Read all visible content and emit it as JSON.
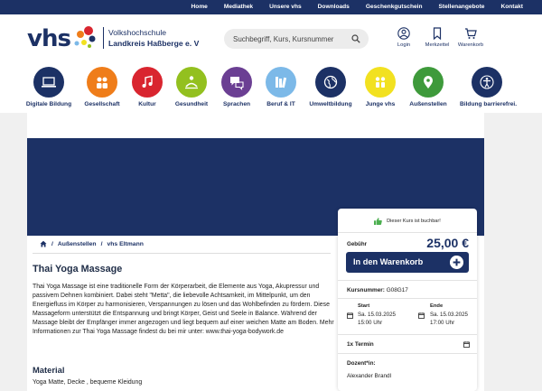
{
  "topnav": [
    "Home",
    "Mediathek",
    "Unsere vhs",
    "Downloads",
    "Geschenkgutschein",
    "Stellenangebote",
    "Kontakt"
  ],
  "logo": {
    "text": "vhs",
    "org_line1": "Volkshochschule",
    "org_line2": "Landkreis Haßberge e. V"
  },
  "search": {
    "placeholder": "Suchbegriff, Kurs, Kursnummer"
  },
  "header_icons": [
    {
      "label": "Login",
      "icon": "user-icon"
    },
    {
      "label": "Merkzettel",
      "icon": "bookmark-icon"
    },
    {
      "label": "Warenkorb",
      "icon": "cart-icon"
    }
  ],
  "categories": [
    {
      "label": "Digitale Bildung",
      "color": "#1c3165",
      "icon": "laptop-icon"
    },
    {
      "label": "Gesellschaft",
      "color": "#ef7d1a",
      "icon": "people-icon"
    },
    {
      "label": "Kultur",
      "color": "#d9252f",
      "icon": "music-icon"
    },
    {
      "label": "Gesundheit",
      "color": "#93c01f",
      "icon": "wellness-icon"
    },
    {
      "label": "Sprachen",
      "color": "#6b3f93",
      "icon": "speech-icon"
    },
    {
      "label": "Beruf & IT",
      "color": "#7cb9e8",
      "icon": "books-icon"
    },
    {
      "label": "Umweltbildung",
      "color": "#1c3165",
      "icon": "globe-icon"
    },
    {
      "label": "Junge vhs",
      "color": "#f2e120",
      "icon": "kids-icon"
    },
    {
      "label": "Außenstellen",
      "color": "#3e9a3b",
      "icon": "map-pin-icon"
    },
    {
      "label": "Bildung barrierefrei.",
      "color": "#1c3165",
      "icon": "accessibility-icon"
    }
  ],
  "breadcrumb": {
    "item1": "Außenstellen",
    "separator": "/",
    "item2": "vhs Eltmann"
  },
  "course": {
    "title": "Thai Yoga Massage",
    "description": "Thai Yoga Massage ist eine traditionelle Form der Körperarbeit, die Elemente aus Yoga, Akupressur und passivem Dehnen kombiniert. Dabei steht \"Metta\", die liebevolle Achtsamkeit, im Mittelpunkt, um den Energiefluss im Körper zu harmonisieren, Verspannungen zu lösen und das Wohlbefinden zu fördern. Diese Massageform unterstützt die Entspannung und bringt Körper, Geist und Seele in Balance. Während der Massage bleibt der Empfänger immer angezogen und liegt bequem auf einer weichen Matte am Boden. Mehr Informationen zur Thai Yoga Massage findest du bei mir unter: www.thai-yoga-bodywork.de",
    "material_heading": "Material",
    "material_text": "Yoga Matte, Decke , bequeme Kleidung"
  },
  "booking": {
    "status": "Dieser Kurs ist buchbar!",
    "fee_label": "Gebühr",
    "price": "25,00 €",
    "cart_button": "In den Warenkorb",
    "course_number_label": "Kursnummer:",
    "course_number": "G08G17",
    "start_label": "Start",
    "start_date": "Sa. 15.03.2025",
    "start_time": "15:00 Uhr",
    "end_label": "Ende",
    "end_date": "Sa. 15.03.2025",
    "end_time": "17:00 Uhr",
    "sessions": "1x Termin",
    "lecturer_label": "Dozent*in:",
    "lecturer": "Alexander Brandl"
  },
  "colors": {
    "primary": "#1c3165",
    "background": "#f0f0f0",
    "like": "#4caf50"
  }
}
